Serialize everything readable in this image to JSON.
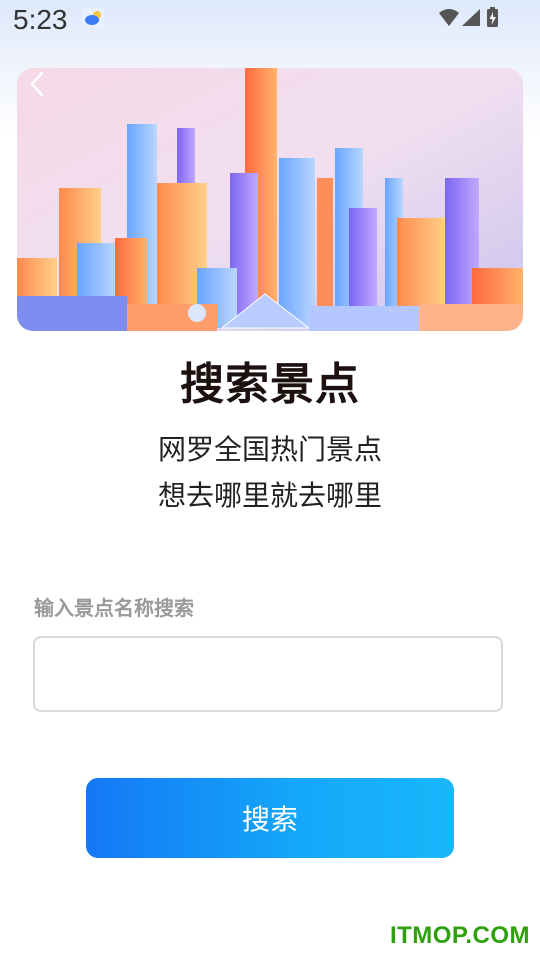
{
  "status_bar": {
    "time": "5:23",
    "icons": [
      "weather-icon",
      "wifi-icon",
      "signal-icon",
      "battery-charging-icon"
    ]
  },
  "banner": {
    "image": "city-skyline-illustration",
    "back_icon": "chevron-left-icon"
  },
  "content": {
    "title": "搜索景点",
    "subtitle_line1": "网罗全国热门景点",
    "subtitle_line2": "想去哪里就去哪里"
  },
  "search": {
    "label": "输入景点名称搜索",
    "value": "",
    "placeholder": "",
    "button_label": "搜索"
  },
  "watermark": "ITMOP.COM",
  "colors": {
    "button_start": "#1478f5",
    "button_end": "#1ab6fb",
    "watermark": "#2fa10d",
    "title": "#1c1010"
  }
}
